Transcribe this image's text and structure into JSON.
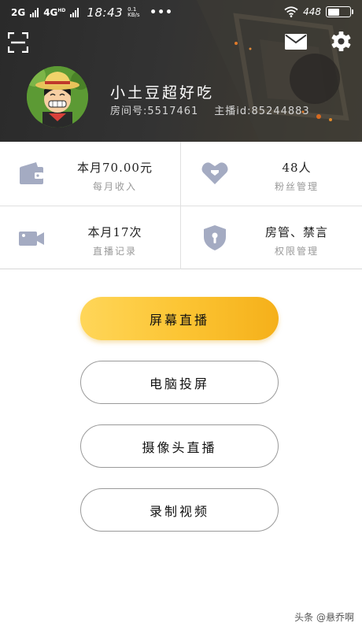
{
  "status_bar": {
    "network_1": "2G",
    "network_2": "4G",
    "network_2_sup": "HD",
    "time": "18:43",
    "speed_top": "0.1",
    "speed_unit": "KB/s",
    "more": "•••",
    "battery_text": "448",
    "battery_level": 0.55
  },
  "header": {
    "scan_icon": "scan-icon",
    "mail_icon": "mail-icon",
    "settings_icon": "gear-icon",
    "username": "小土豆超好吃",
    "room_label": "房间号:5517461",
    "anchor_label": "主播id:85244883"
  },
  "stats": [
    {
      "icon": "wallet-icon",
      "value": "本月70.00元",
      "label": "每月收入"
    },
    {
      "icon": "heart-tag-icon",
      "value": "48人",
      "label": "粉丝管理"
    },
    {
      "icon": "video-camera-icon",
      "value": "本月17次",
      "label": "直播记录"
    },
    {
      "icon": "shield-icon",
      "value": "房管、禁言",
      "label": "权限管理"
    }
  ],
  "actions": {
    "screen_live": "屏幕直播",
    "pc_cast": "电脑投屏",
    "camera_live": "摄像头直播",
    "record_video": "录制视频"
  },
  "watermark": "头条 @悬乔啊",
  "colors": {
    "accent": "#fcc534",
    "icon_gray": "#a4abc2",
    "header_dark": "#2f2f2f"
  }
}
